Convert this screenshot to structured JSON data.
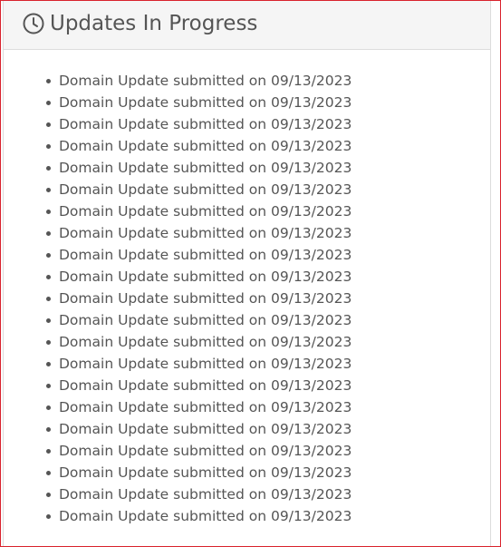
{
  "panel": {
    "title": "Updates In Progress",
    "icon": "clock-icon",
    "accent_border_color": "#d9232d"
  },
  "updates": [
    "Domain Update submitted on 09/13/2023",
    "Domain Update submitted on 09/13/2023",
    "Domain Update submitted on 09/13/2023",
    "Domain Update submitted on 09/13/2023",
    "Domain Update submitted on 09/13/2023",
    "Domain Update submitted on 09/13/2023",
    "Domain Update submitted on 09/13/2023",
    "Domain Update submitted on 09/13/2023",
    "Domain Update submitted on 09/13/2023",
    "Domain Update submitted on 09/13/2023",
    "Domain Update submitted on 09/13/2023",
    "Domain Update submitted on 09/13/2023",
    "Domain Update submitted on 09/13/2023",
    "Domain Update submitted on 09/13/2023",
    "Domain Update submitted on 09/13/2023",
    "Domain Update submitted on 09/13/2023",
    "Domain Update submitted on 09/13/2023",
    "Domain Update submitted on 09/13/2023",
    "Domain Update submitted on 09/13/2023",
    "Domain Update submitted on 09/13/2023",
    "Domain Update submitted on 09/13/2023"
  ]
}
